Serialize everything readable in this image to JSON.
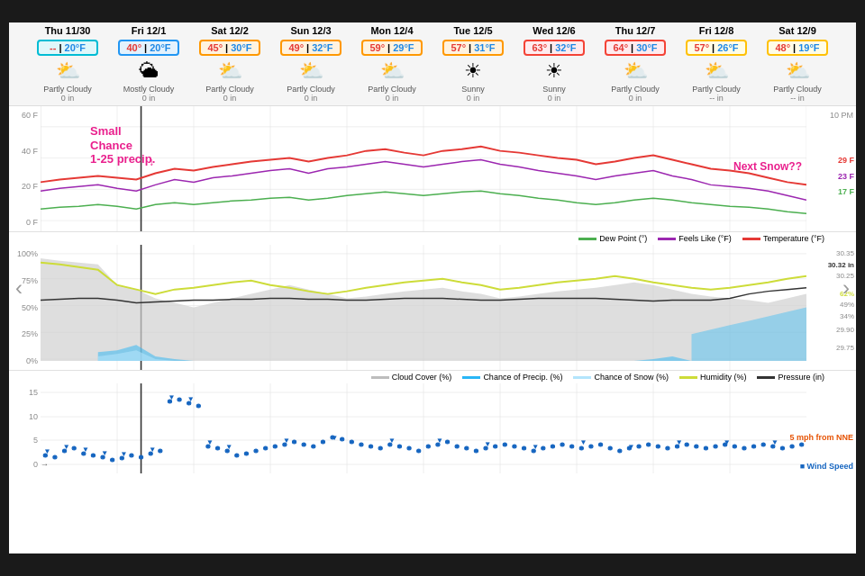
{
  "nav": {
    "left_arrow": "‹",
    "right_arrow": "›"
  },
  "days": [
    {
      "id": "thu-1130",
      "title": "Thu 11/30",
      "high": "--",
      "low": "20°F",
      "box_style": "cyan-border",
      "icon": "⛅",
      "condition": "Partly Cloudy",
      "precip": "0 in"
    },
    {
      "id": "fri-121",
      "title": "Fri 12/1",
      "high": "40°",
      "low": "20°F",
      "box_style": "blue-border",
      "icon": "🌥",
      "condition": "Mostly Cloudy",
      "precip": "0 in"
    },
    {
      "id": "sat-122",
      "title": "Sat 12/2",
      "high": "45°",
      "low": "30°F",
      "box_style": "orange-border",
      "icon": "⛅",
      "condition": "Partly Cloudy",
      "precip": "0 in"
    },
    {
      "id": "sun-123",
      "title": "Sun 12/3",
      "high": "49°",
      "low": "32°F",
      "box_style": "orange-border",
      "icon": "⛅",
      "condition": "Partly Cloudy",
      "precip": "0 in"
    },
    {
      "id": "mon-124",
      "title": "Mon 12/4",
      "high": "59°",
      "low": "29°F",
      "box_style": "orange-border",
      "icon": "⛅",
      "condition": "Partly Cloudy",
      "precip": "0 in"
    },
    {
      "id": "tue-125",
      "title": "Tue 12/5",
      "high": "57°",
      "low": "31°F",
      "box_style": "orange-border",
      "icon": "☀",
      "condition": "Sunny",
      "precip": "0 in"
    },
    {
      "id": "wed-126",
      "title": "Wed 12/6",
      "high": "63°",
      "low": "32°F",
      "box_style": "red-border",
      "icon": "☀",
      "condition": "Sunny",
      "precip": "0 in"
    },
    {
      "id": "thu-127",
      "title": "Thu 12/7",
      "high": "64°",
      "low": "30°F",
      "box_style": "red-border",
      "icon": "⛅",
      "condition": "Partly Cloudy",
      "precip": "0 in"
    },
    {
      "id": "fri-128",
      "title": "Fri 12/8",
      "high": "57°",
      "low": "26°F",
      "box_style": "yellow-border",
      "icon": "⛅",
      "condition": "Partly Cloudy",
      "precip": "-- in"
    },
    {
      "id": "sat-129",
      "title": "Sat 12/9",
      "high": "48°",
      "low": "19°F",
      "box_style": "yellow-border",
      "icon": "⛅",
      "condition": "Partly Cloudy",
      "precip": "-- in"
    }
  ],
  "temp_chart": {
    "y_labels": [
      "60 F",
      "40 F",
      "20 F",
      "0 F"
    ],
    "right_labels": [
      {
        "value": "29 F",
        "color": "#e53935"
      },
      {
        "value": "23 F",
        "color": "#9c27b0"
      },
      {
        "value": "17 F",
        "color": "#4caf50"
      }
    ],
    "time_label": "10 PM"
  },
  "temp_legend": [
    {
      "label": "Dew Point (°)",
      "color": "#4caf50"
    },
    {
      "label": "Feels Like (°F)",
      "color": "#9c27b0"
    },
    {
      "label": "Temperature (°F)",
      "color": "#e53935"
    }
  ],
  "humid_chart": {
    "y_labels": [
      "100%",
      "75%",
      "50%",
      "25%",
      "0%"
    ],
    "right_labels": [
      {
        "value": "30.35",
        "color": "#888"
      },
      {
        "value": "30.32 in",
        "color": "#333"
      },
      {
        "value": "30.25",
        "color": "#888"
      },
      {
        "value": "62%",
        "color": "#cddc39"
      },
      {
        "value": "49%",
        "color": "#888"
      },
      {
        "value": "34%",
        "color": "#888"
      },
      {
        "value": "29.90",
        "color": "#888"
      },
      {
        "value": "29.75",
        "color": "#888"
      }
    ]
  },
  "humid_legend": [
    {
      "label": "Cloud Cover (%)",
      "color": "#bdbdbd"
    },
    {
      "label": "Chance of Precip. (%)",
      "color": "#29b6f6"
    },
    {
      "label": "Chance of Snow (%)",
      "color": "#b3e5fc"
    },
    {
      "label": "Humidity (%)",
      "color": "#cddc39"
    },
    {
      "label": "Pressure (in)",
      "color": "#333"
    }
  ],
  "wind_chart": {
    "y_labels": [
      "15",
      "10",
      "5",
      "0"
    ],
    "right_label": "5 mph from NNE",
    "right_label_color": "#e65100",
    "legend": "Wind Speed",
    "legend_color": "#1565c0"
  },
  "annotations": {
    "small_chance": "Small\nChance\n1-25 precip.",
    "next_snow": "Next Snow??"
  }
}
